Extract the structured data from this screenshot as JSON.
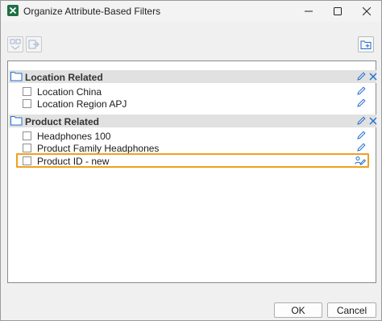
{
  "window": {
    "title": "Organize Attribute-Based Filters"
  },
  "colors": {
    "accent": "#1f6fd1",
    "highlight_border": "#f0a020",
    "excel_green": "#1d7044",
    "group_header_bg": "#e1e1e1"
  },
  "toolbar": {
    "icons": [
      "move-to-group-icon",
      "move-out-icon",
      "new-group-icon"
    ]
  },
  "groups": [
    {
      "title": "Location Related",
      "items": [
        {
          "label": "Location China",
          "icon": "pencil-icon"
        },
        {
          "label": "Location Region APJ",
          "icon": "pencil-icon"
        }
      ]
    },
    {
      "title": "Product Related",
      "items": [
        {
          "label": "Headphones 100",
          "icon": "pencil-icon"
        },
        {
          "label": "Product Family Headphones",
          "icon": "pencil-icon"
        },
        {
          "label": "Product ID - new",
          "icon": "shared-edit-icon"
        }
      ]
    }
  ],
  "buttons": {
    "ok": "OK",
    "cancel": "Cancel"
  }
}
